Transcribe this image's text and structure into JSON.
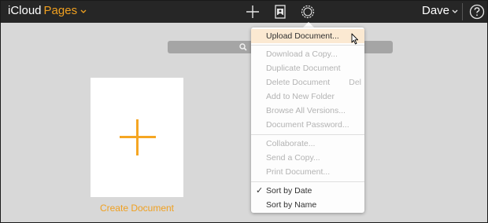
{
  "topbar": {
    "brand_icloud": "iCloud",
    "brand_app": "Pages",
    "brand_chevron_icon": "chevron-down-icon",
    "add_icon": "plus-icon",
    "templates_icon": "document-image-icon",
    "settings_icon": "gear-icon",
    "user_name": "Dave",
    "user_chevron_icon": "chevron-down-icon",
    "help_icon": "question-circle-icon"
  },
  "search": {
    "icon": "search-icon"
  },
  "main": {
    "create_document_label": "Create Document",
    "create_icon": "plus-icon"
  },
  "menu": {
    "items": [
      {
        "label": "Upload Document...",
        "enabled": true,
        "hover": true
      },
      {
        "label": "Download a Copy...",
        "enabled": false
      },
      {
        "label": "Duplicate Document",
        "enabled": false
      },
      {
        "label": "Delete Document",
        "enabled": false,
        "shortcut": "Del"
      },
      {
        "label": "Add to New Folder",
        "enabled": false
      },
      {
        "label": "Browse All Versions...",
        "enabled": false
      },
      {
        "label": "Document Password...",
        "enabled": false
      },
      {
        "label": "Collaborate...",
        "enabled": false
      },
      {
        "label": "Send a Copy...",
        "enabled": false
      },
      {
        "label": "Print Document...",
        "enabled": false
      },
      {
        "label": "Sort by Date",
        "enabled": true,
        "checked": true
      },
      {
        "label": "Sort by Name",
        "enabled": true
      }
    ]
  },
  "colors": {
    "accent_orange": "#f0a020",
    "topbar_bg": "#262626",
    "page_bg": "#d8d8d8",
    "menu_hover": "#fbe9d2"
  }
}
